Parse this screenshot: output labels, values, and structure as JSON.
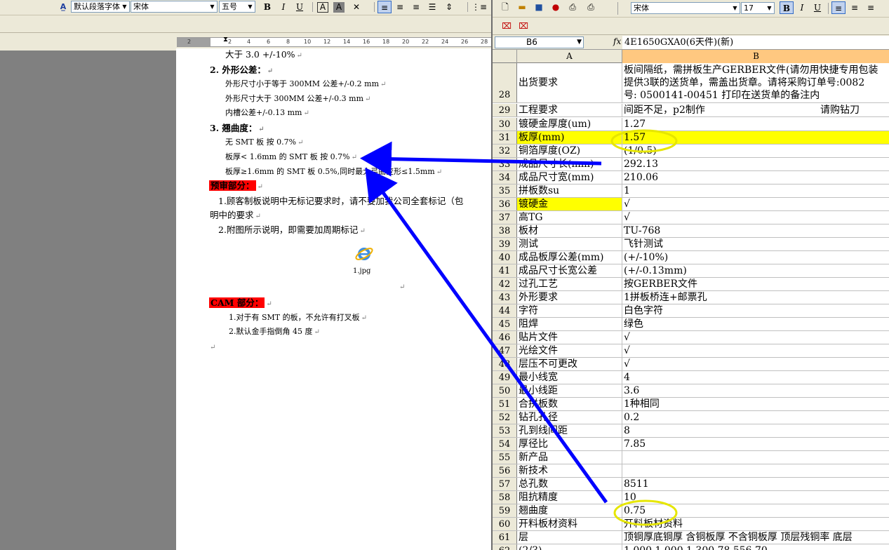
{
  "word": {
    "toolbar": {
      "style_name": "默认段落字体",
      "font_name": "宋体",
      "font_size": "五号",
      "bold": "B",
      "italic": "I",
      "underline": "U",
      "char_border": "A",
      "char_shade": "A"
    },
    "ruler_ticks": [
      "2",
      "2",
      "4",
      "6",
      "8",
      "10",
      "12",
      "14",
      "16",
      "18",
      "20",
      "22",
      "24",
      "26",
      "28"
    ],
    "lines": [
      "大于 3.0                +/-10%",
      "2.  外形公差：",
      "外形尺寸小于等于 300MM  公差+/-0.2  mm",
      "外形尺寸大于 300MM      公差+/-0.3  mm",
      "内槽公差+/-0.13  mm",
      "3.  翘曲度：",
      "无 SMT 板              按 0.7%",
      "板厚< 1.6mm 的 SMT 板   按 0.7%",
      "板厚≥1.6mm 的 SMT 板    0.5%,同时最大弓曲变形≤1.5mm",
      "预审部分：",
      "1.顾客制板说明中无标记要求时，请不要加我公司全套标记（包",
      "明中的要求",
      "2.附图所示说明，即需要加周期标记",
      "1.jpg",
      "CAM 部分：",
      "1.对于有 SMT 的板，不允许有打叉板",
      "2.默认金手指倒角 45 度"
    ],
    "para_mark": "↵"
  },
  "excel": {
    "font_name": "宋体",
    "font_size": "17",
    "bold": "B",
    "italic": "I",
    "underline": "U",
    "name_box": "B6",
    "fx": "fx",
    "formula": "4E1650GXA0(6天件)(新)",
    "columns": [
      "A",
      "B"
    ],
    "row28": {
      "num": "28",
      "a": "出货要求",
      "b1": "板间隔纸，需拼板生产GERBER文件(请勿用快捷专用包装",
      "b2": "提供3联的送货单，需盖出货章。请将采购订单号:0082",
      "b3": "号: 0500141-00451 打印在送货单的备注内"
    },
    "row29": {
      "num": "29",
      "a": "工程要求",
      "b": "间距不足，p2制作",
      "b_extra": "请购钻刀"
    },
    "rows": [
      {
        "num": "30",
        "a": "镀硬金厚度(um)",
        "b": "1.27",
        "hl": false
      },
      {
        "num": "31",
        "a": "板厚(mm)",
        "b": "1.57",
        "hl": true
      },
      {
        "num": "32",
        "a": "铜箔厚度(OZ)",
        "b": "(1/0.5)",
        "hl": false
      },
      {
        "num": "33",
        "a": "成品尺寸长(mm)",
        "b": "292.13",
        "hl": false
      },
      {
        "num": "34",
        "a": "成品尺寸宽(mm)",
        "b": "210.06",
        "hl": false
      },
      {
        "num": "35",
        "a": "拼板数su",
        "b": "1",
        "hl": false
      },
      {
        "num": "36",
        "a": "镀硬金",
        "b": "√",
        "hl": true
      },
      {
        "num": "37",
        "a": "高TG",
        "b": "√",
        "hl": false
      },
      {
        "num": "38",
        "a": "板材",
        "b": "TU-768",
        "hl": false
      },
      {
        "num": "39",
        "a": "测试",
        "b": "飞针测试",
        "hl": false
      },
      {
        "num": "40",
        "a": "成品板厚公差(mm)",
        "b": "(+/-10%)",
        "hl": false
      },
      {
        "num": "41",
        "a": "成品尺寸长宽公差",
        "b": "(+/-0.13mm)",
        "hl": false
      },
      {
        "num": "42",
        "a": "过孔工艺",
        "b": "按GERBER文件",
        "hl": false
      },
      {
        "num": "43",
        "a": "外形要求",
        "b": "1拼板桥连+邮票孔",
        "hl": false
      },
      {
        "num": "44",
        "a": "字符",
        "b": "白色字符",
        "hl": false
      },
      {
        "num": "45",
        "a": "阻焊",
        "b": "绿色",
        "hl": false
      },
      {
        "num": "46",
        "a": "贴片文件",
        "b": "√",
        "hl": false
      },
      {
        "num": "47",
        "a": "光绘文件",
        "b": "√",
        "hl": false
      },
      {
        "num": "48",
        "a": "层压不可更改",
        "b": "√",
        "hl": false
      },
      {
        "num": "49",
        "a": "最小线宽",
        "b": "4",
        "hl": false
      },
      {
        "num": "50",
        "a": "最小线距",
        "b": "3.6",
        "hl": false
      },
      {
        "num": "51",
        "a": "合拼板数",
        "b": "1种相同",
        "hl": false
      },
      {
        "num": "52",
        "a": "钻孔孔径",
        "b": "0.2",
        "hl": false
      },
      {
        "num": "53",
        "a": "孔到线间距",
        "b": "8",
        "hl": false
      },
      {
        "num": "54",
        "a": "厚径比",
        "b": "7.85",
        "hl": false
      },
      {
        "num": "55",
        "a": "新产品",
        "b": "",
        "hl": false
      },
      {
        "num": "56",
        "a": "新技术",
        "b": "",
        "hl": false
      },
      {
        "num": "57",
        "a": "总孔数",
        "b": "8511",
        "hl": false
      },
      {
        "num": "58",
        "a": "阻抗精度",
        "b": "10",
        "hl": false
      },
      {
        "num": "59",
        "a": "翘曲度",
        "b": "0.75",
        "hl": false
      },
      {
        "num": "60",
        "a": "开料板材资料",
        "b": "开料板材资料",
        "hl": false
      },
      {
        "num": "61",
        "a": "层",
        "b": "顶铜厚底铜厚 含铜板厚 不含铜板厚 顶层残铜率 底层",
        "hl": false
      },
      {
        "num": "62",
        "a": "(2/3)",
        "b": "1.000  1.000   1.300          78.556   70.",
        "hl": false
      }
    ]
  },
  "colors": {
    "annotation_arrow": "#0000ff",
    "highlight_ellipse": "#e6e600",
    "cell_highlight": "#ffff00",
    "section_header_bg": "#ff0000"
  }
}
